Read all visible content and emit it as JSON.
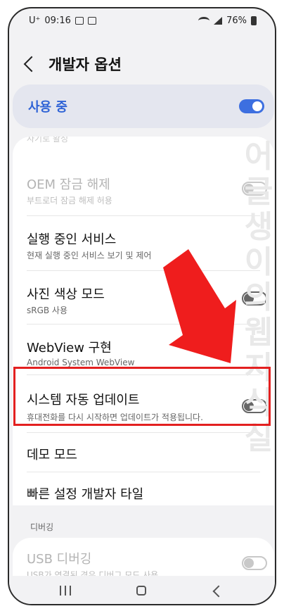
{
  "status_bar": {
    "carrier": "U⁺",
    "time": "09:16",
    "battery": "76%"
  },
  "app_bar": {
    "title": "개발자 옵션"
  },
  "master_toggle": {
    "label": "사용 중",
    "state": "on"
  },
  "rows": [
    {
      "title": "OEM 잠금 해제",
      "subtitle": "부트로더 잠금 해제 허용",
      "toggle": "disabled"
    },
    {
      "title": "실행 중인 서비스",
      "subtitle": "현재 실행 중인 서비스 보기 및 제어"
    },
    {
      "title": "사진 색상 모드",
      "subtitle": "sRGB 사용",
      "toggle": "off"
    },
    {
      "title": "WebView 구현",
      "subtitle": "Android System WebView"
    },
    {
      "title": "시스템 자동 업데이트",
      "subtitle": "휴대전화를 다시 시작하면 업데이트가 적용됩니다.",
      "toggle": "off"
    },
    {
      "title": "데모 모드"
    },
    {
      "title": "빠른 설정 개발자 타일"
    }
  ],
  "clipped_row_text": "자기로 활성",
  "section_debugging": {
    "header": "디버깅",
    "usb_title": "USB 디버깅",
    "usb_subtitle": "USB가 연결된 경우 디버그 모드 사용",
    "usb_toggle": "disabled"
  },
  "watermark": "어글생이의웹지식실",
  "colors": {
    "accent": "#3d6fe0",
    "highlight": "#e32020",
    "arrow": "#ef1d1d"
  }
}
